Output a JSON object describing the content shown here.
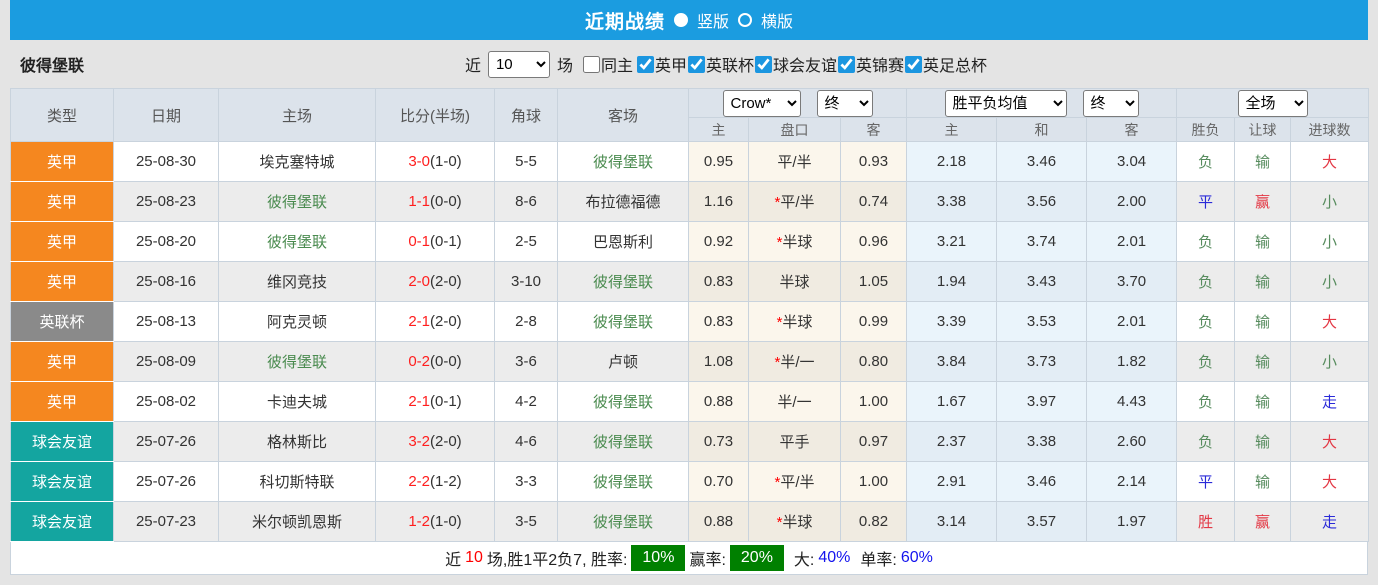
{
  "colors": {
    "header_blue": "#1b9ce0",
    "league": {
      "英甲": "#f5871f",
      "英联杯": "#8a8a8a",
      "球会友谊": "#14a5a0"
    },
    "result": {
      "r": "#e33744",
      "g": "#578c5e",
      "b": "#2a2ad8"
    },
    "score_red": "#ff1e1e",
    "badge_green": "#008000"
  },
  "title_bar": {
    "title": "近期战绩",
    "vertical_label": "竖版",
    "horizontal_label": "横版"
  },
  "filter_bar": {
    "team_name": "彼得堡联",
    "recent_label": "近",
    "recent_count": "10",
    "matches_label": "场",
    "same_home_label": "同主",
    "league_filters": [
      "英甲",
      "英联杯",
      "球会友谊",
      "英锦赛",
      "英足总杯"
    ]
  },
  "table": {
    "main_headers": [
      "类型",
      "日期",
      "主场",
      "比分(半场)",
      "角球",
      "客场"
    ],
    "dropdowns": {
      "company": "Crow*",
      "company_period": "终",
      "average": "胜平负均值",
      "average_period": "终",
      "scope": "全场"
    },
    "sub_headers": [
      "主",
      "盘口",
      "客",
      "主",
      "和",
      "客",
      "胜负",
      "让球",
      "进球数"
    ],
    "rows": [
      {
        "type": "英甲",
        "date": "25-08-30",
        "home": "埃克塞特城",
        "home_self": false,
        "score": "3-0",
        "half": "(1-0)",
        "corner": "5-5",
        "away": "彼得堡联",
        "away_self": true,
        "star": false,
        "odds": [
          "0.95",
          "平/半",
          "0.93"
        ],
        "avg": [
          "2.18",
          "3.46",
          "3.04"
        ],
        "wdl": {
          "t": "负",
          "c": "g"
        },
        "handicap_result": {
          "t": "输",
          "c": "g"
        },
        "goals": {
          "t": "大",
          "c": "r"
        }
      },
      {
        "type": "英甲",
        "date": "25-08-23",
        "home": "彼得堡联",
        "home_self": true,
        "score": "1-1",
        "half": "(0-0)",
        "corner": "8-6",
        "away": "布拉德福德",
        "away_self": false,
        "star": true,
        "odds": [
          "1.16",
          "平/半",
          "0.74"
        ],
        "avg": [
          "3.38",
          "3.56",
          "2.00"
        ],
        "wdl": {
          "t": "平",
          "c": "b"
        },
        "handicap_result": {
          "t": "赢",
          "c": "r"
        },
        "goals": {
          "t": "小",
          "c": "g"
        }
      },
      {
        "type": "英甲",
        "date": "25-08-20",
        "home": "彼得堡联",
        "home_self": true,
        "score": "0-1",
        "half": "(0-1)",
        "corner": "2-5",
        "away": "巴恩斯利",
        "away_self": false,
        "star": true,
        "odds": [
          "0.92",
          "半球",
          "0.96"
        ],
        "avg": [
          "3.21",
          "3.74",
          "2.01"
        ],
        "wdl": {
          "t": "负",
          "c": "g"
        },
        "handicap_result": {
          "t": "输",
          "c": "g"
        },
        "goals": {
          "t": "小",
          "c": "g"
        }
      },
      {
        "type": "英甲",
        "date": "25-08-16",
        "home": "维冈竞技",
        "home_self": false,
        "score": "2-0",
        "half": "(2-0)",
        "corner": "3-10",
        "away": "彼得堡联",
        "away_self": true,
        "star": false,
        "odds": [
          "0.83",
          "半球",
          "1.05"
        ],
        "avg": [
          "1.94",
          "3.43",
          "3.70"
        ],
        "wdl": {
          "t": "负",
          "c": "g"
        },
        "handicap_result": {
          "t": "输",
          "c": "g"
        },
        "goals": {
          "t": "小",
          "c": "g"
        }
      },
      {
        "type": "英联杯",
        "date": "25-08-13",
        "home": "阿克灵顿",
        "home_self": false,
        "score": "2-1",
        "half": "(2-0)",
        "corner": "2-8",
        "away": "彼得堡联",
        "away_self": true,
        "star": true,
        "odds": [
          "0.83",
          "半球",
          "0.99"
        ],
        "avg": [
          "3.39",
          "3.53",
          "2.01"
        ],
        "wdl": {
          "t": "负",
          "c": "g"
        },
        "handicap_result": {
          "t": "输",
          "c": "g"
        },
        "goals": {
          "t": "大",
          "c": "r"
        }
      },
      {
        "type": "英甲",
        "date": "25-08-09",
        "home": "彼得堡联",
        "home_self": true,
        "score": "0-2",
        "half": "(0-0)",
        "corner": "3-6",
        "away": "卢顿",
        "away_self": false,
        "star": true,
        "odds": [
          "1.08",
          "半/一",
          "0.80"
        ],
        "avg": [
          "3.84",
          "3.73",
          "1.82"
        ],
        "wdl": {
          "t": "负",
          "c": "g"
        },
        "handicap_result": {
          "t": "输",
          "c": "g"
        },
        "goals": {
          "t": "小",
          "c": "g"
        }
      },
      {
        "type": "英甲",
        "date": "25-08-02",
        "home": "卡迪夫城",
        "home_self": false,
        "score": "2-1",
        "half": "(0-1)",
        "corner": "4-2",
        "away": "彼得堡联",
        "away_self": true,
        "star": false,
        "odds": [
          "0.88",
          "半/一",
          "1.00"
        ],
        "avg": [
          "1.67",
          "3.97",
          "4.43"
        ],
        "wdl": {
          "t": "负",
          "c": "g"
        },
        "handicap_result": {
          "t": "输",
          "c": "g"
        },
        "goals": {
          "t": "走",
          "c": "b"
        }
      },
      {
        "type": "球会友谊",
        "date": "25-07-26",
        "home": "格林斯比",
        "home_self": false,
        "score": "3-2",
        "half": "(2-0)",
        "corner": "4-6",
        "away": "彼得堡联",
        "away_self": true,
        "star": false,
        "odds": [
          "0.73",
          "平手",
          "0.97"
        ],
        "avg": [
          "2.37",
          "3.38",
          "2.60"
        ],
        "wdl": {
          "t": "负",
          "c": "g"
        },
        "handicap_result": {
          "t": "输",
          "c": "g"
        },
        "goals": {
          "t": "大",
          "c": "r"
        }
      },
      {
        "type": "球会友谊",
        "date": "25-07-26",
        "home": "科切斯特联",
        "home_self": false,
        "score": "2-2",
        "half": "(1-2)",
        "corner": "3-3",
        "away": "彼得堡联",
        "away_self": true,
        "star": true,
        "odds": [
          "0.70",
          "平/半",
          "1.00"
        ],
        "avg": [
          "2.91",
          "3.46",
          "2.14"
        ],
        "wdl": {
          "t": "平",
          "c": "b"
        },
        "handicap_result": {
          "t": "输",
          "c": "g"
        },
        "goals": {
          "t": "大",
          "c": "r"
        }
      },
      {
        "type": "球会友谊",
        "date": "25-07-23",
        "home": "米尔顿凯恩斯",
        "home_self": false,
        "score": "1-2",
        "half": "(1-0)",
        "corner": "3-5",
        "away": "彼得堡联",
        "away_self": true,
        "star": true,
        "odds": [
          "0.88",
          "半球",
          "0.82"
        ],
        "avg": [
          "3.14",
          "3.57",
          "1.97"
        ],
        "wdl": {
          "t": "胜",
          "c": "r"
        },
        "handicap_result": {
          "t": "赢",
          "c": "r"
        },
        "goals": {
          "t": "走",
          "c": "b"
        }
      }
    ]
  },
  "footer": {
    "seg_recent": "近",
    "games_count": "10",
    "seg_summary": "场,胜1平2负7, 胜率:",
    "win_rate": "10%",
    "seg_profit": "赢率:",
    "profit_rate": "20%",
    "seg_big": "大:",
    "big_rate": "40%",
    "seg_single": "单率:",
    "single_rate": "60%"
  }
}
